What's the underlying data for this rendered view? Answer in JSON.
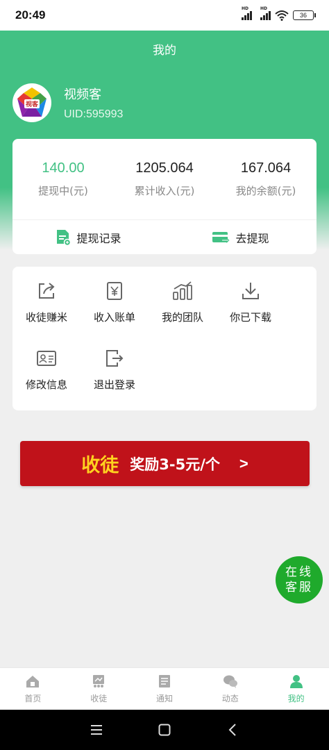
{
  "status": {
    "time": "20:49",
    "battery": "36",
    "signal_label": "HD"
  },
  "header": {
    "title": "我的"
  },
  "profile": {
    "name": "视频客",
    "uid": "UID:595993",
    "avatar_text": "视客"
  },
  "stats": [
    {
      "value": "140.00",
      "label": "提现中(元)"
    },
    {
      "value": "1205.064",
      "label": "累计收入(元)"
    },
    {
      "value": "167.064",
      "label": "我的余额(元)"
    }
  ],
  "actions": {
    "withdraw_record": "提现记录",
    "withdraw": "去提现"
  },
  "menu": [
    {
      "label": "收徒赚米",
      "icon": "share-icon"
    },
    {
      "label": "收入账单",
      "icon": "yen-icon"
    },
    {
      "label": "我的团队",
      "icon": "team-chart-icon"
    },
    {
      "label": "你已下载",
      "icon": "download-icon"
    },
    {
      "label": "修改信息",
      "icon": "id-card-icon"
    },
    {
      "label": "退出登录",
      "icon": "logout-icon"
    }
  ],
  "promo": {
    "main": "收徒",
    "sub": "奖励3-5元/个",
    "arrow": ">"
  },
  "online_service": {
    "label": "在线客服"
  },
  "tabs": [
    {
      "label": "首页",
      "icon": "home-icon"
    },
    {
      "label": "收徒",
      "icon": "apprentice-icon"
    },
    {
      "label": "通知",
      "icon": "notice-icon"
    },
    {
      "label": "动态",
      "icon": "chat-icon"
    },
    {
      "label": "我的",
      "icon": "user-icon",
      "active": true
    }
  ],
  "colors": {
    "primary": "#42c184",
    "promo_bg": "#c0121a",
    "promo_highlight": "#ffd21f",
    "service_bg": "#1faa2c"
  }
}
